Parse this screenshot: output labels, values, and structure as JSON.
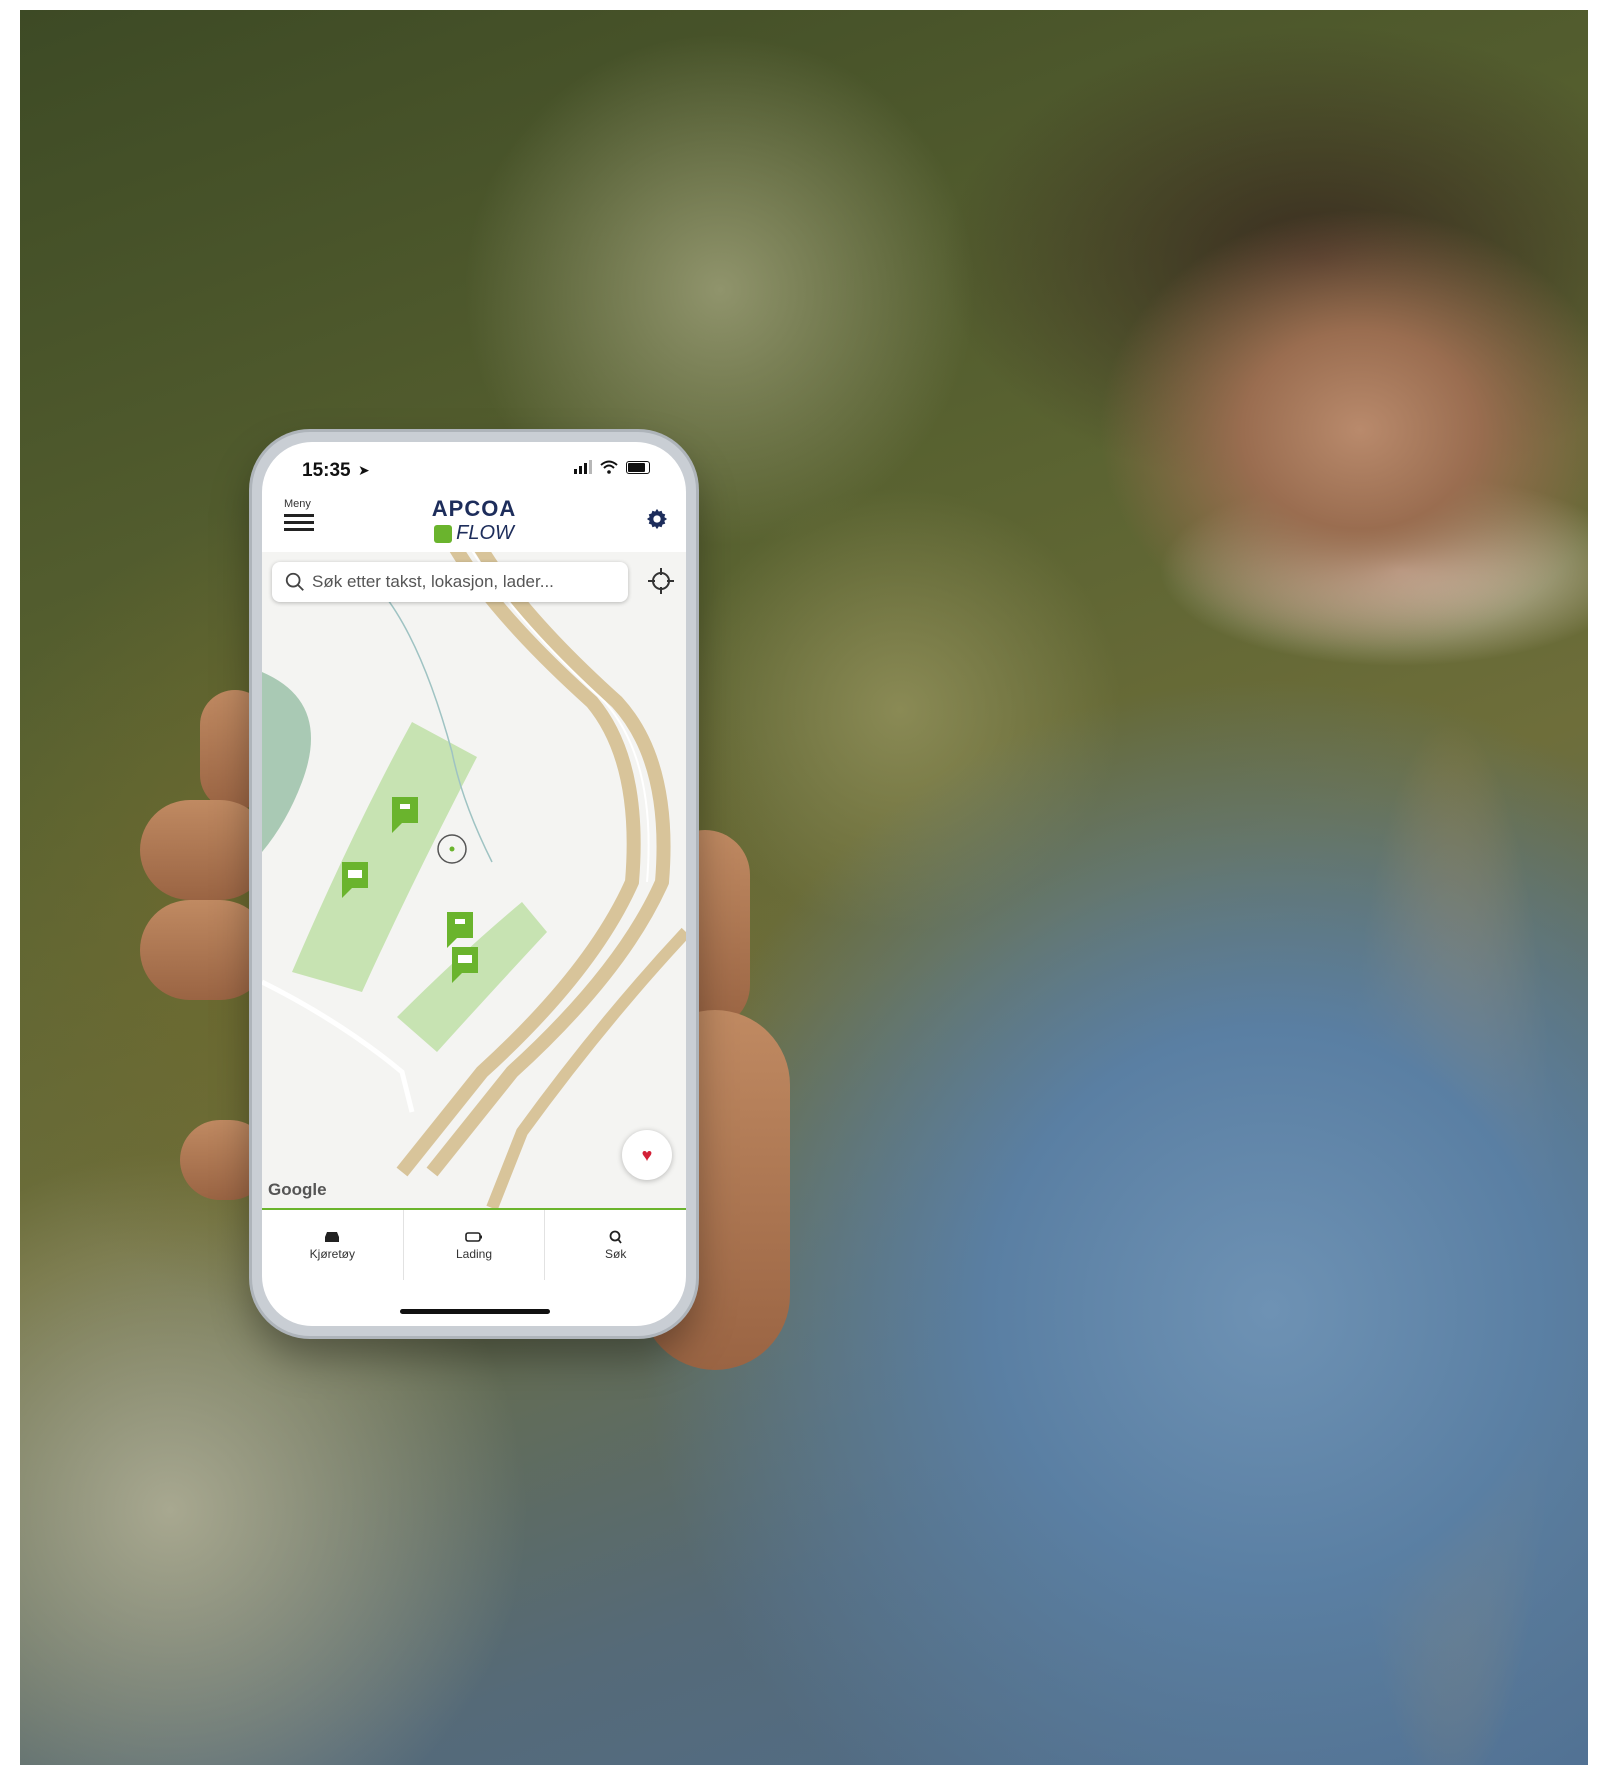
{
  "status_bar": {
    "time": "15:35"
  },
  "header": {
    "menu_label": "Meny",
    "logo_top": "APCOA",
    "logo_bottom": "FLOW"
  },
  "search": {
    "placeholder": "Søk etter takst, lokasjon, lader..."
  },
  "map": {
    "attribution": "Google"
  },
  "tabs": [
    {
      "label": "Kjøretøy",
      "icon": "car-icon"
    },
    {
      "label": "Lading",
      "icon": "battery-icon"
    },
    {
      "label": "Søk",
      "icon": "search-icon"
    }
  ],
  "colors": {
    "brand_green": "#6ab42d",
    "brand_navy": "#1d2d5b",
    "road": "#d8c49a",
    "park": "#c7e3b2",
    "favorite": "#d32037"
  }
}
